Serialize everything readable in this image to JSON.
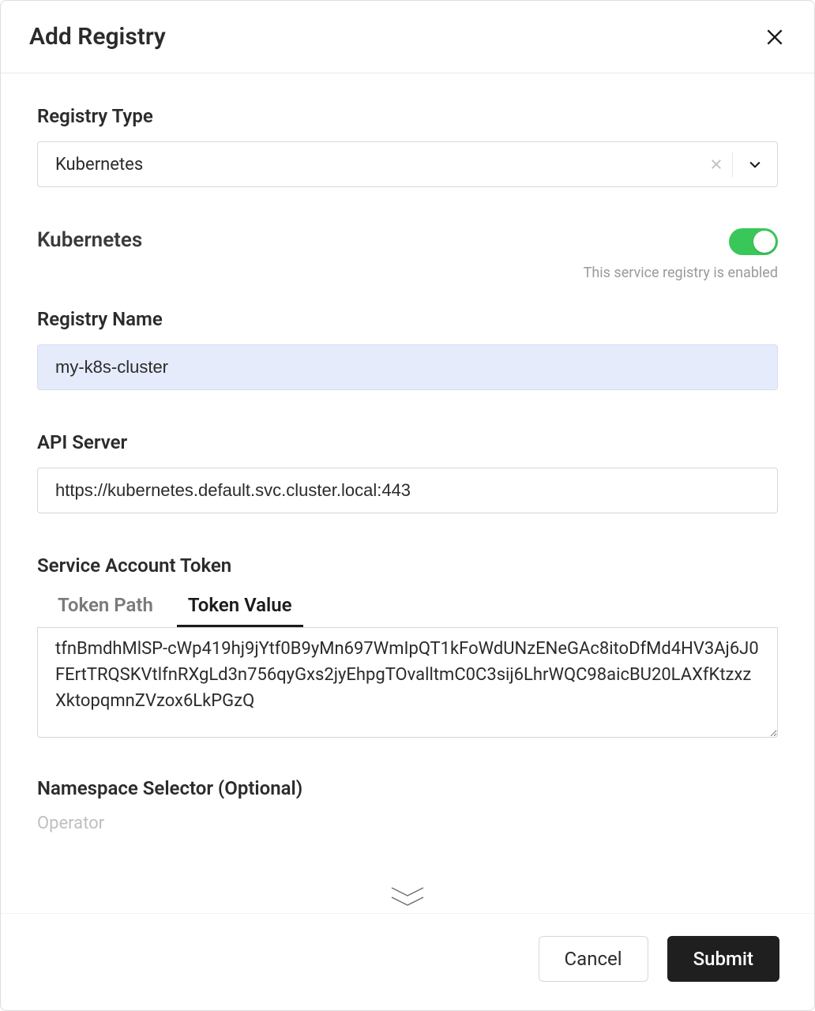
{
  "modal": {
    "title": "Add Registry"
  },
  "registryType": {
    "label": "Registry Type",
    "value": "Kubernetes"
  },
  "kubernetes": {
    "section_title": "Kubernetes",
    "enabled_hint": "This service registry is enabled"
  },
  "registryName": {
    "label": "Registry Name",
    "value": "my-k8s-cluster"
  },
  "apiServer": {
    "label": "API Server",
    "value": "https://kubernetes.default.svc.cluster.local:443"
  },
  "token": {
    "label": "Service Account Token",
    "tabs": {
      "path": "Token Path",
      "value": "Token Value"
    },
    "textarea_value": "tfnBmdhMlSP-cWp419hj9jYtf0B9yMn697WmIpQT1kFoWdUNzENeGAc8itoDfMd4HV3Aj6J0FErtTRQSKVtlfnRXgLd3n756qyGxs2jyEhpgTOvalltmC0C3sij6LhrWQC98aicBU20LAXfKtzxzXktopqmnZVzox6LkPGzQ"
  },
  "namespaceSelector": {
    "label": "Namespace Selector (Optional)",
    "operator_placeholder": "Operator"
  },
  "footer": {
    "cancel": "Cancel",
    "submit": "Submit"
  }
}
